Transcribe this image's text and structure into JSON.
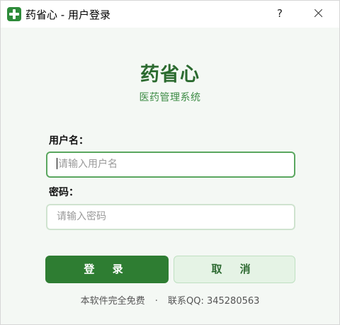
{
  "window": {
    "title": "药省心 - 用户登录",
    "help_label": "?",
    "accent_color": "#2e7d32"
  },
  "brand": {
    "name": "药省心",
    "subtitle": "医药管理系统"
  },
  "form": {
    "username_label": "用户名：",
    "username_placeholder": "请输入用户名",
    "username_value": "",
    "password_label": "密码：",
    "password_placeholder": "请输入密码",
    "password_value": ""
  },
  "buttons": {
    "login_label": "登 录",
    "cancel_label": "取 消"
  },
  "footer": {
    "free_text": "本软件完全免费",
    "separator": "·",
    "contact_text": "联系QQ: 345280563"
  },
  "icons": {
    "app": "medical-cross-icon",
    "close": "close-icon"
  }
}
